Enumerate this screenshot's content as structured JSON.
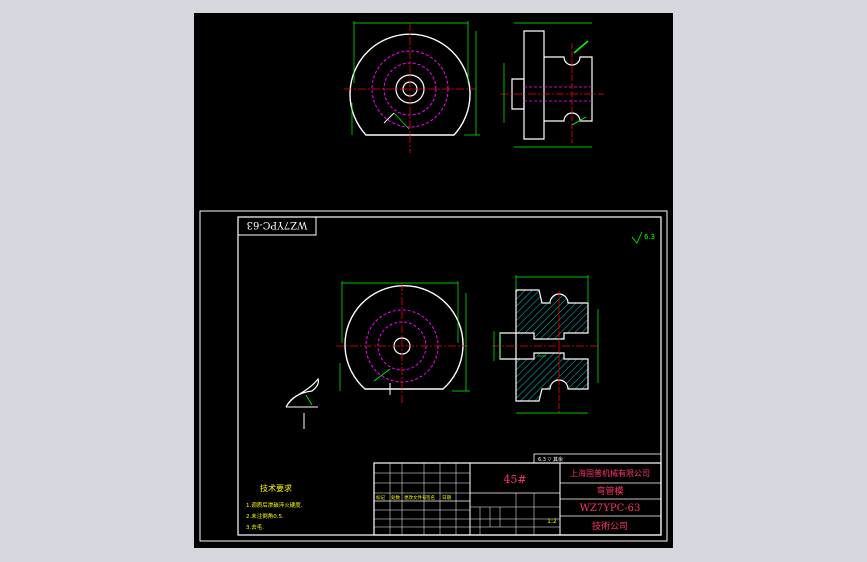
{
  "drawing": {
    "sheet_title_mirrored": "WZ7YPC-63",
    "roughness_symbol": "6.3",
    "tech_req_title": "技术要求",
    "tech_req_items": [
      "1.调质后渗碳淬火硬度.",
      "2.未注倒角0.5.",
      "3.去毛."
    ],
    "material": "45#",
    "company": "上海固普机械有限公司",
    "part_name": "弯管模",
    "drawing_no": "WZ7YPC-63",
    "department": "技術公司",
    "scale": "1:2",
    "top_right_label": "6.3 ▽ 其余",
    "title_small_labels": [
      "标记",
      "处数",
      "更改文件号",
      "签名",
      "日期"
    ]
  },
  "colors": {
    "background": "#000000",
    "outline": "#ffffff",
    "dimension": "#00ff00",
    "center_line": "#ff0000",
    "hidden": "#ff00ff",
    "hatch": "#00ffff",
    "accent": "#ffff00"
  }
}
